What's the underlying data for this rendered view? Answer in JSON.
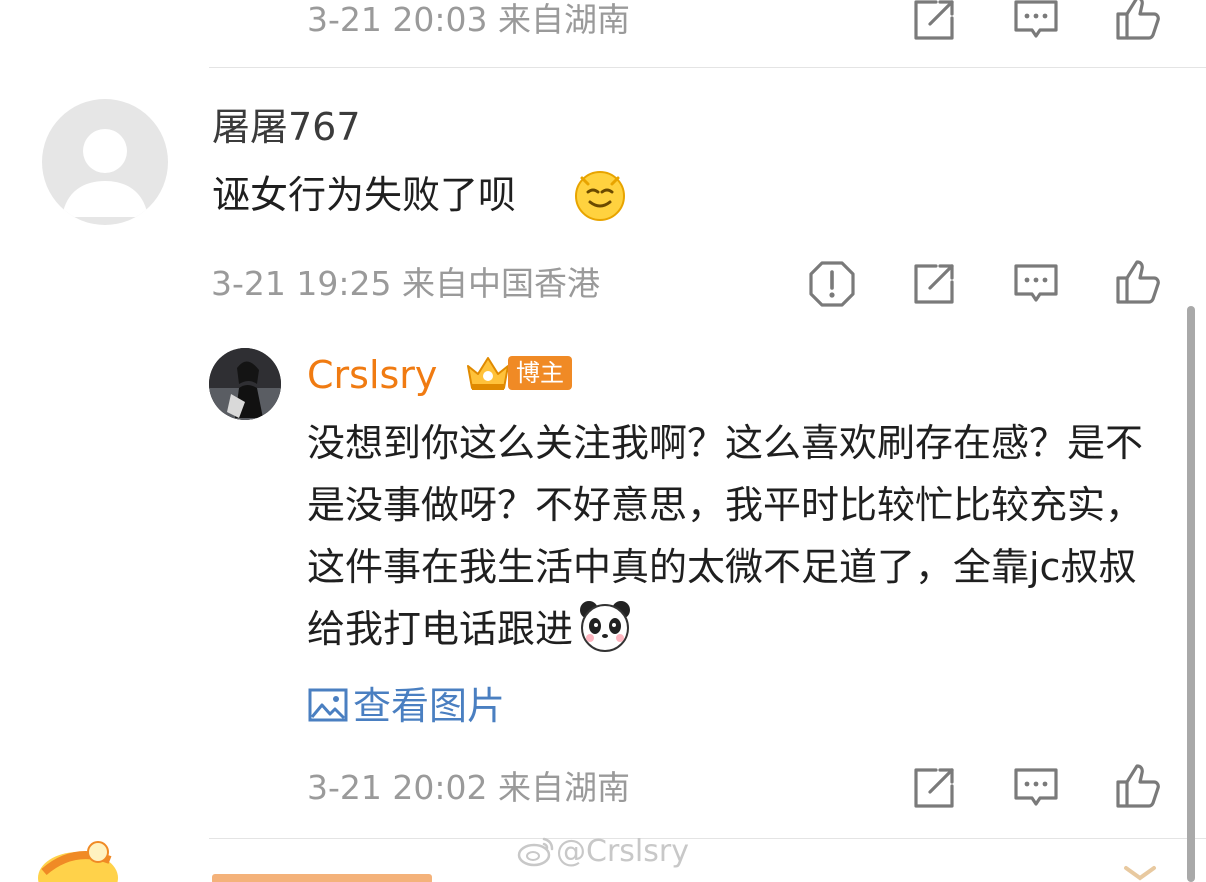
{
  "comments": [
    {
      "meta": "3-21 20:03 来自湖南"
    },
    {
      "username": "屠屠767",
      "text": "诬女行为失败了呗",
      "meta": "3-21 19:25 来自中国香港"
    },
    {
      "username": "Crslsry",
      "badge": "博主",
      "text": "没想到你这么关注我啊？这么喜欢刷存在感？是不是没事做呀？不好意思，我平时比较忙比较充实，这件事在我生活中真的太微不足道了，全靠jc叔叔给我打电话跟进",
      "view_images": "查看图片",
      "meta": "3-21 20:02 来自湖南"
    }
  ],
  "icons": {
    "report": "report-icon",
    "share": "share-icon",
    "reply": "comment-icon",
    "like": "like-icon",
    "emoji_smile": "smile-emoji-icon",
    "emoji_panda": "panda-emoji-icon",
    "image": "image-icon"
  },
  "watermark": "@Crslsry",
  "colors": {
    "meta_text": "#9a9a9a",
    "username_gray": "#3b3b3b",
    "username_blogger": "#f07b12",
    "link_blue": "#4a7fc1",
    "badge_orange": "#f08a25"
  }
}
